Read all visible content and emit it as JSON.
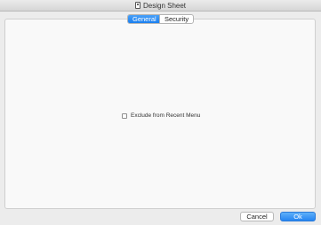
{
  "window": {
    "title": "Design Sheet",
    "icon": "document-icon"
  },
  "tabs": [
    {
      "label": "General",
      "selected": true
    },
    {
      "label": "Security",
      "selected": false
    }
  ],
  "general": {
    "exclude_from_recent_menu": {
      "label": "Exclude from Recent Menu",
      "checked": false
    }
  },
  "buttons": {
    "cancel": "Cancel",
    "ok": "Ok"
  },
  "colors": {
    "accent": "#1a7ff0",
    "background": "#ececec",
    "panel": "#f9f9f9"
  }
}
